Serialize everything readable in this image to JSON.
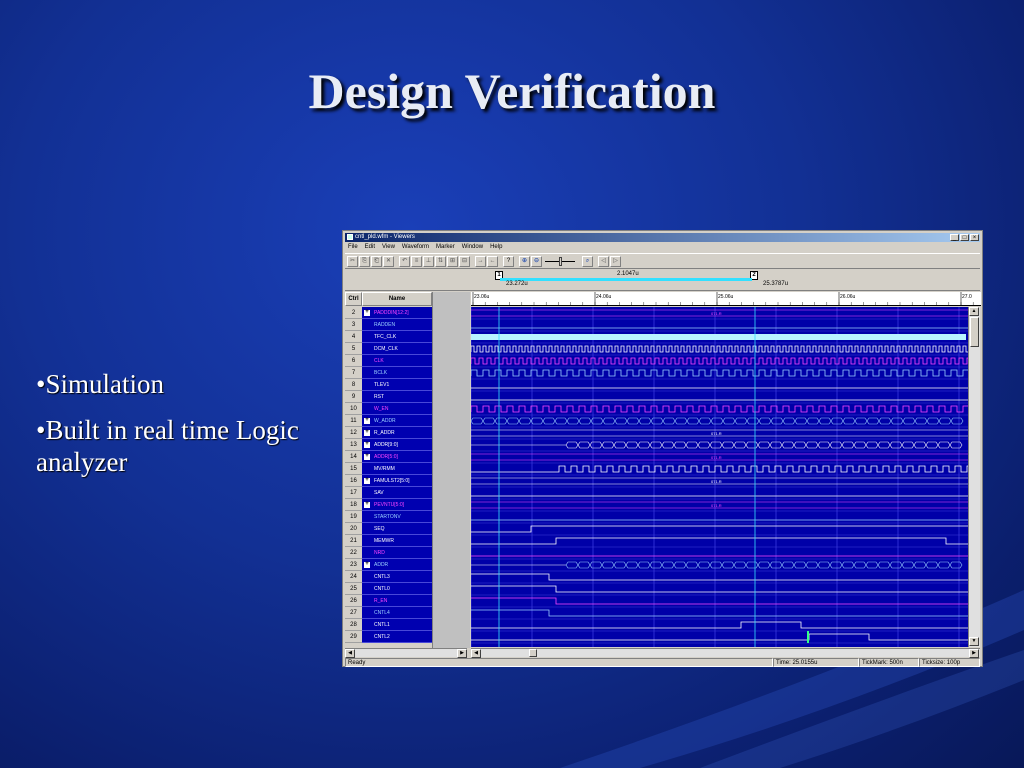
{
  "slide": {
    "title": "Design Verification",
    "bullets": [
      "•Simulation",
      "•Built in real time Logic analyzer"
    ]
  },
  "window": {
    "title": "cntl_pld.wfm - Viewers",
    "controls": [
      "_",
      "□",
      "×"
    ],
    "menu": [
      "File",
      "Edit",
      "View",
      "Waveform",
      "Marker",
      "Window",
      "Help"
    ]
  },
  "markers": {
    "m1": {
      "label": "1",
      "time": "23.272u"
    },
    "m2": {
      "label": "2",
      "time": "25.3787u"
    },
    "delta": "2.1047u"
  },
  "columns": {
    "ctrl": "Ctrl",
    "name": "Name"
  },
  "ruler": {
    "ticks": [
      "23.06u",
      "24.06u",
      "25.06u",
      "26.06u",
      "27.0"
    ]
  },
  "signals": [
    {
      "num": "2",
      "name": "PADDDIN[12:2]",
      "color": "#ff44ff",
      "group": true,
      "wave": "bus",
      "label": "071.R"
    },
    {
      "num": "3",
      "name": "RADDEN",
      "color": "#9ad0ff",
      "group": false,
      "wave": "low"
    },
    {
      "num": "4",
      "name": "TFC_CLK",
      "color": "#ffffff",
      "group": false,
      "wave": "solid"
    },
    {
      "num": "5",
      "name": "DCM_CLK",
      "color": "#ffffff",
      "group": false,
      "wave": "clk",
      "period": 6
    },
    {
      "num": "6",
      "name": "CLK",
      "color": "#ff44ff",
      "group": false,
      "wave": "clk",
      "period": 8
    },
    {
      "num": "7",
      "name": "BCLK",
      "color": "#9ad0ff",
      "group": false,
      "wave": "clk",
      "period": 12
    },
    {
      "num": "8",
      "name": "TLEV1",
      "color": "#ffffff",
      "group": false,
      "wave": "low"
    },
    {
      "num": "9",
      "name": "RST",
      "color": "#ffffff",
      "group": false,
      "wave": "low"
    },
    {
      "num": "10",
      "name": "W_EN",
      "color": "#ff44ff",
      "group": false,
      "wave": "clk",
      "period": 12
    },
    {
      "num": "11",
      "name": "W_ADDR",
      "color": "#9ad0ff",
      "group": true,
      "wave": "busseq",
      "start": 0
    },
    {
      "num": "12",
      "name": "R_ADDR",
      "color": "#ffffff",
      "group": true,
      "wave": "bus",
      "label": "071.R"
    },
    {
      "num": "13",
      "name": "ADDR[9:0]",
      "color": "#ffffff",
      "group": true,
      "wave": "busseq",
      "start": 95
    },
    {
      "num": "14",
      "name": "ADDR[5:0]",
      "color": "#ff44ff",
      "group": true,
      "wave": "bus",
      "label": "071.R"
    },
    {
      "num": "15",
      "name": "MV/RMM",
      "color": "#ffffff",
      "group": false,
      "wave": "clk",
      "period": 12,
      "start": 88
    },
    {
      "num": "16",
      "name": "FAMULST2[5:0]",
      "color": "#ffffff",
      "group": true,
      "wave": "bus",
      "label": "071.R"
    },
    {
      "num": "17",
      "name": "SAV",
      "color": "#ffffff",
      "group": false,
      "wave": "low"
    },
    {
      "num": "18",
      "name": "PEVNTU[5:0]",
      "color": "#ff44ff",
      "group": true,
      "wave": "bus",
      "label": "071.R"
    },
    {
      "num": "19",
      "name": "STARTONV",
      "color": "#9ad0ff",
      "group": false,
      "wave": "low"
    },
    {
      "num": "20",
      "name": "SEQ",
      "color": "#ffffff",
      "group": false,
      "wave": "step",
      "edges": [
        60
      ]
    },
    {
      "num": "21",
      "name": "MEMWR",
      "color": "#ffffff",
      "group": false,
      "wave": "step",
      "edges": [
        85,
        475
      ]
    },
    {
      "num": "22",
      "name": "NRD",
      "color": "#ff44ff",
      "group": false,
      "wave": "low"
    },
    {
      "num": "23",
      "name": "ADDR",
      "color": "#9ad0ff",
      "group": true,
      "wave": "busseq",
      "start": 95
    },
    {
      "num": "24",
      "name": "CNTL3",
      "color": "#ffffff",
      "group": false,
      "wave": "fall",
      "edges": [
        78
      ]
    },
    {
      "num": "25",
      "name": "CNTL0",
      "color": "#ffffff",
      "group": false,
      "wave": "fall",
      "edges": [
        85
      ]
    },
    {
      "num": "26",
      "name": "R_EN",
      "color": "#ff44ff",
      "group": false,
      "wave": "fall",
      "edges": [
        85
      ]
    },
    {
      "num": "27",
      "name": "CNTL4",
      "color": "#9ad0ff",
      "group": false,
      "wave": "fall",
      "edges": [
        78
      ]
    },
    {
      "num": "28",
      "name": "CNTL1",
      "color": "#ffffff",
      "group": false,
      "wave": "step",
      "edges": [
        270,
        330
      ]
    },
    {
      "num": "29",
      "name": "CNTL2",
      "color": "#ffffff",
      "group": false,
      "wave": "step",
      "edges": [
        338,
        398
      ]
    }
  ],
  "colors": {
    "wave_bg": "#0000a8",
    "grid": "#5a5aff",
    "cursor": "#33e0ff",
    "bus": "#ffffff"
  },
  "status": {
    "ready": "Ready",
    "time": "Time: 25.0155u",
    "tickmark": "TickMark: 500n",
    "ticksize": "Ticksize: 100p"
  }
}
